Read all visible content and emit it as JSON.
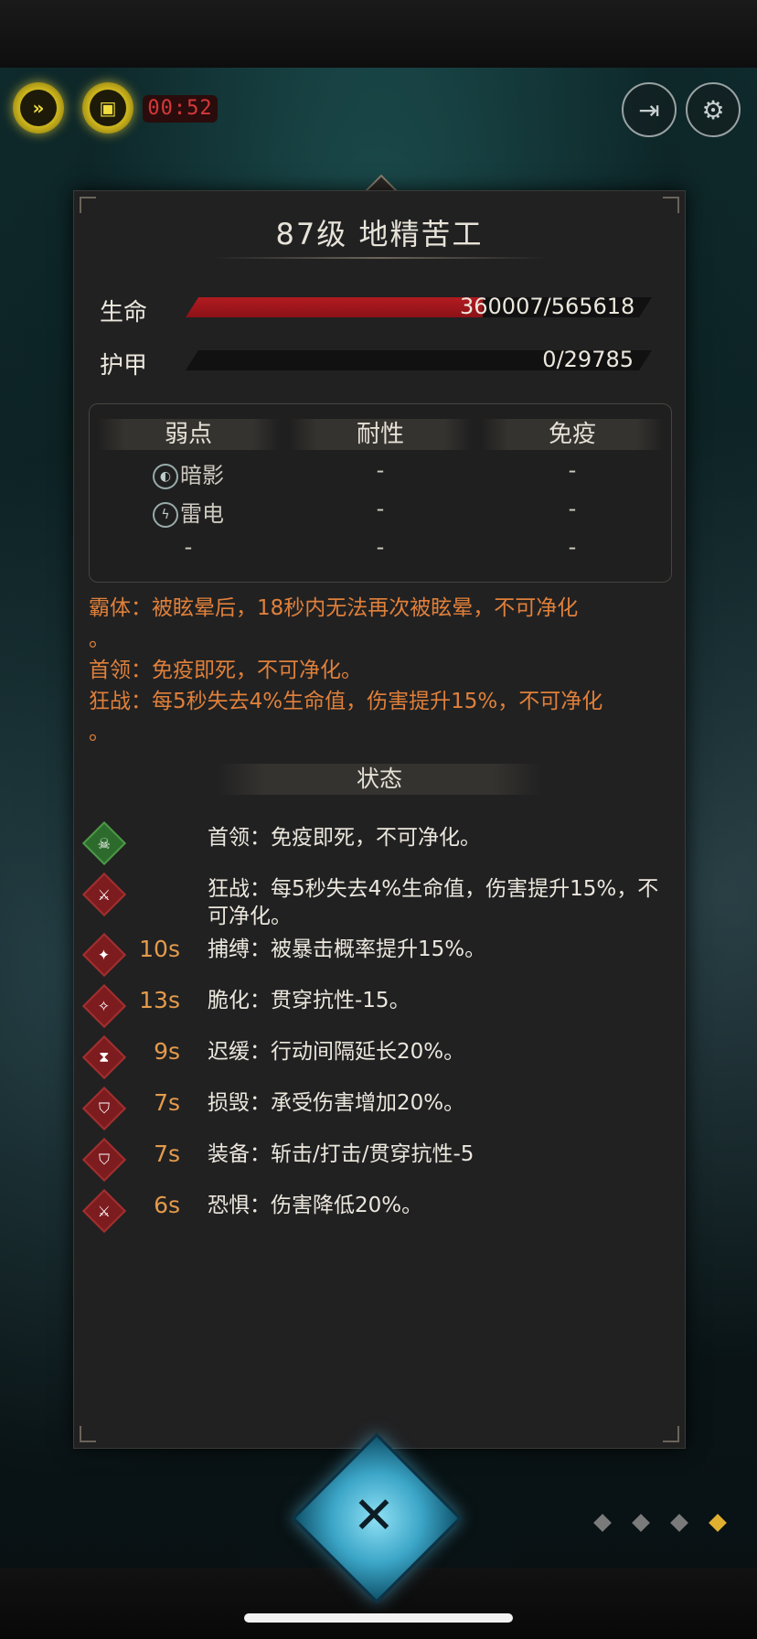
{
  "hud": {
    "timer": "00:52",
    "fast_forward_icon": "fast-forward-icon",
    "auto_icon": "auto-battle-icon",
    "exit_icon": "exit-icon",
    "settings_icon": "gear-icon"
  },
  "monster": {
    "title": "87级 地精苦工",
    "hp_label": "生命",
    "hp_value": "360007/565618",
    "hp_fraction": 0.6365,
    "armor_label": "护甲",
    "armor_value": "0/29785",
    "armor_fraction": 0
  },
  "resistances": {
    "headers": [
      "弱点",
      "耐性",
      "免疫"
    ],
    "rows": [
      [
        "暗影",
        "-",
        "-"
      ],
      [
        "雷电",
        "-",
        "-"
      ],
      [
        "-",
        "-",
        "-"
      ]
    ]
  },
  "traits": [
    "霸体：被眩晕后，18秒内无法再次被眩晕，不可净化",
    "。",
    "首领：免疫即死，不可净化。",
    "狂战：每5秒失去4%生命值，伤害提升15%，不可净化",
    "。"
  ],
  "status_section_title": "状态",
  "statuses": [
    {
      "icon": "skull-icon",
      "duration": "",
      "text": "首领：免疫即死，不可净化。"
    },
    {
      "icon": "berserk-icon",
      "duration": "",
      "text": "狂战：每5秒失去4%生命值，伤害提升15%，不可净化。"
    },
    {
      "icon": "bind-icon",
      "duration": "10s",
      "text": "捕缚：被暴击概率提升15%。"
    },
    {
      "icon": "brittle-icon",
      "duration": "13s",
      "text": "脆化：贯穿抗性-15。"
    },
    {
      "icon": "hourglass-icon",
      "duration": "9s",
      "text": "迟缓：行动间隔延长20%。"
    },
    {
      "icon": "shield-break-icon",
      "duration": "7s",
      "text": "损毁：承受伤害增加20%。"
    },
    {
      "icon": "shield-icon",
      "duration": "7s",
      "text": "装备：斩击/打击/贯穿抗性-5"
    },
    {
      "icon": "fear-icon",
      "duration": "6s",
      "text": "恐惧：伤害降低20%。"
    }
  ],
  "close_icon": "close-icon"
}
